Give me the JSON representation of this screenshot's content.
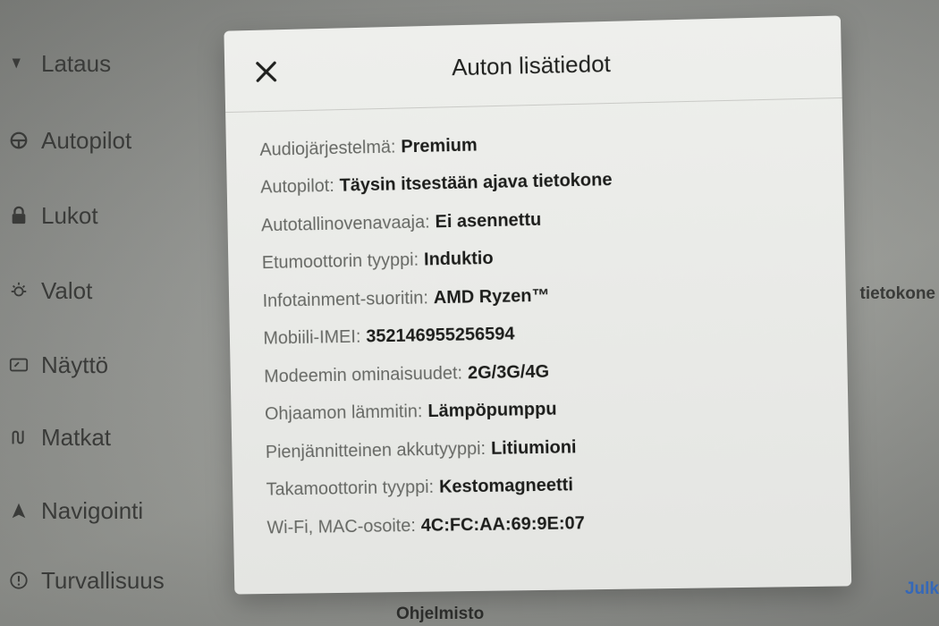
{
  "sidebar": {
    "items": [
      {
        "label": "Lataus",
        "icon": "lightning-icon"
      },
      {
        "label": "Autopilot",
        "icon": "steering-wheel-icon"
      },
      {
        "label": "Lukot",
        "icon": "lock-icon"
      },
      {
        "label": "Valot",
        "icon": "sun-icon"
      },
      {
        "label": "Näyttö",
        "icon": "display-icon"
      },
      {
        "label": "Matkat",
        "icon": "trips-icon"
      },
      {
        "label": "Navigointi",
        "icon": "navigation-arrow-icon"
      },
      {
        "label": "Turvallisuus",
        "icon": "alert-circle-icon"
      }
    ]
  },
  "background": {
    "right_text": "tietokone",
    "right_link": "Julk",
    "bottom_text": "Ohjelmisto"
  },
  "modal": {
    "title": "Auton lisätiedot",
    "rows": [
      {
        "label": "Audiojärjestelmä",
        "value": "Premium"
      },
      {
        "label": "Autopilot",
        "value": "Täysin itsestään ajava tietokone"
      },
      {
        "label": "Autotallinovenavaaja",
        "value": "Ei asennettu"
      },
      {
        "label": "Etumoottorin tyyppi",
        "value": "Induktio"
      },
      {
        "label": "Infotainment-suoritin",
        "value": "AMD Ryzen™"
      },
      {
        "label": "Mobiili-IMEI",
        "value": "352146955256594"
      },
      {
        "label": "Modeemin ominaisuudet",
        "value": "2G/3G/4G"
      },
      {
        "label": "Ohjaamon lämmitin",
        "value": "Lämpöpumppu"
      },
      {
        "label": "Pienjännitteinen akkutyyppi",
        "value": "Litiumioni"
      },
      {
        "label": "Takamoottorin tyyppi",
        "value": "Kestomagneetti"
      },
      {
        "label": "Wi-Fi, MAC-osoite",
        "value": "4C:FC:AA:69:9E:07"
      }
    ]
  },
  "colors": {
    "modal_bg": "#eeefec",
    "label": "#666864",
    "value": "#1c1d1b",
    "link": "#3568b8"
  }
}
